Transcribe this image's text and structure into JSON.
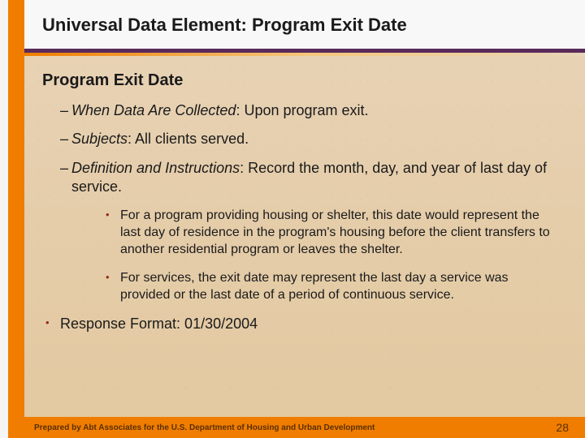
{
  "title": "Universal Data Element: Program Exit Date",
  "section": "Program Exit Date",
  "items": [
    {
      "label": "When Data Are Collected",
      "text": ": Upon program exit."
    },
    {
      "label": "Subjects",
      "text": ":  All clients served."
    },
    {
      "label": "Definition and Instructions",
      "text": ": Record the month, day, and year of last day of service."
    }
  ],
  "subBullets": [
    "For a program providing housing or shelter, this date would represent the last day of residence in the program's housing before the client transfers to another residential program or leaves the shelter.",
    "For services, the exit date may represent the last day a service was provided or the last date of a period of continuous service."
  ],
  "response": "Response Format: 01/30/2004",
  "footer": "Prepared by Abt Associates for the U.S. Department of Housing and Urban Development",
  "pageNumber": "28"
}
